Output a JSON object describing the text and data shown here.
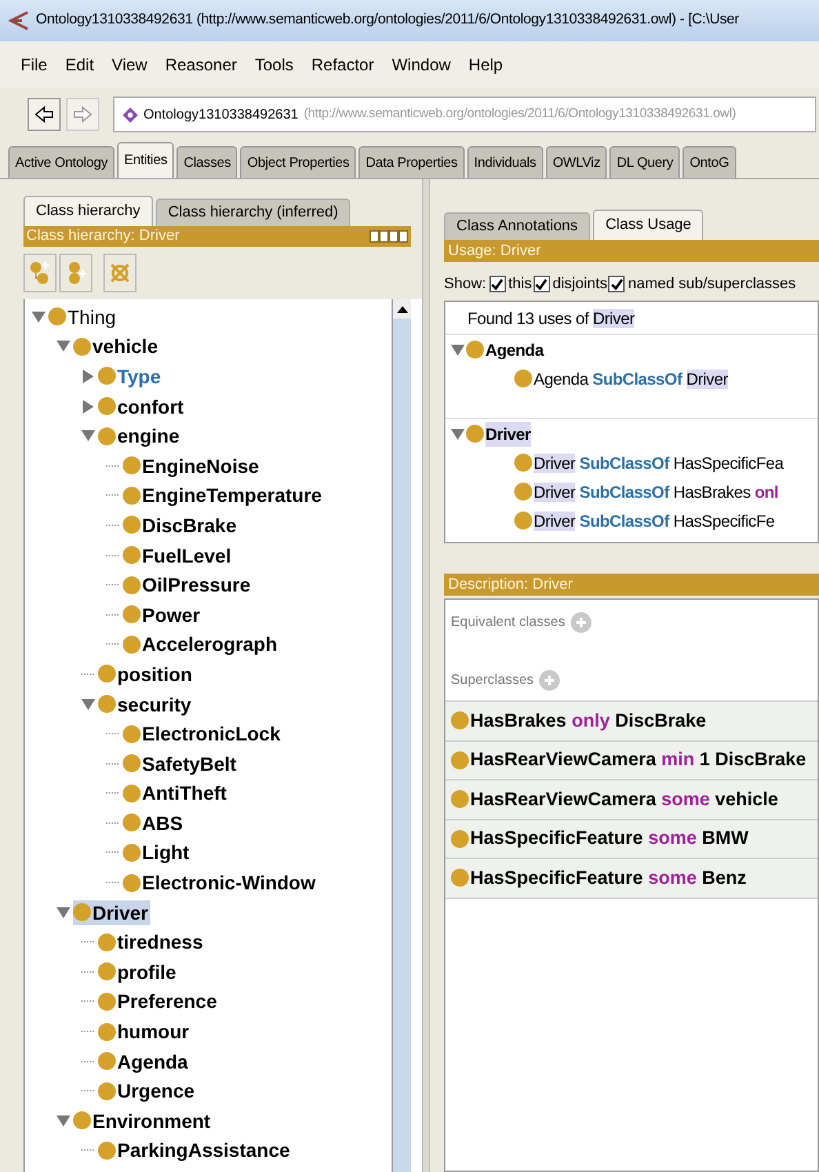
{
  "window": {
    "title": "Ontology1310338492631 (http://www.semanticweb.org/ontologies/2011/6/Ontology1310338492631.owl) - [C:\\User"
  },
  "menu": [
    "File",
    "Edit",
    "View",
    "Reasoner",
    "Tools",
    "Refactor",
    "Window",
    "Help"
  ],
  "nav": {
    "ontology": "Ontology1310338492631",
    "iri": "(http://www.semanticweb.org/ontologies/2011/6/Ontology1310338492631.owl)"
  },
  "tabs": [
    {
      "label": "Active Ontology",
      "selected": false
    },
    {
      "label": "Entities",
      "selected": true
    },
    {
      "label": "Classes",
      "selected": false
    },
    {
      "label": "Object Properties",
      "selected": false
    },
    {
      "label": "Data Properties",
      "selected": false
    },
    {
      "label": "Individuals",
      "selected": false
    },
    {
      "label": "OWLViz",
      "selected": false
    },
    {
      "label": "DL Query",
      "selected": false
    },
    {
      "label": "OntoG",
      "selected": false
    }
  ],
  "hierarchy": {
    "tabs": [
      {
        "label": "Class hierarchy",
        "selected": true
      },
      {
        "label": "Class hierarchy (inferred)",
        "selected": false
      }
    ],
    "header": "Class hierarchy: Driver",
    "tree": [
      {
        "label": "Thing",
        "kind": "branch",
        "expanded": true,
        "selected": false,
        "hovered": false,
        "children": [
          {
            "label": "vehicle",
            "kind": "branch",
            "expanded": true,
            "selected": false,
            "hovered": false,
            "children": [
              {
                "label": "Type",
                "kind": "branch",
                "expanded": false,
                "selected": false,
                "hovered": true
              },
              {
                "label": "confort",
                "kind": "branch",
                "expanded": false,
                "selected": false,
                "hovered": false
              },
              {
                "label": "engine",
                "kind": "branch",
                "expanded": true,
                "selected": false,
                "hovered": false,
                "children": [
                  {
                    "label": "EngineNoise",
                    "kind": "leaf",
                    "selected": false,
                    "hovered": false
                  },
                  {
                    "label": "EngineTemperature",
                    "kind": "leaf",
                    "selected": false,
                    "hovered": false
                  },
                  {
                    "label": "DiscBrake",
                    "kind": "leaf",
                    "selected": false,
                    "hovered": false
                  },
                  {
                    "label": "FuelLevel",
                    "kind": "leaf",
                    "selected": false,
                    "hovered": false
                  },
                  {
                    "label": "OilPressure",
                    "kind": "leaf",
                    "selected": false,
                    "hovered": false
                  },
                  {
                    "label": "Power",
                    "kind": "leaf",
                    "selected": false,
                    "hovered": false
                  },
                  {
                    "label": "Accelerograph",
                    "kind": "leaf",
                    "selected": false,
                    "hovered": false
                  }
                ]
              },
              {
                "label": "position",
                "kind": "leaf",
                "selected": false,
                "hovered": false
              },
              {
                "label": "security",
                "kind": "branch",
                "expanded": true,
                "selected": false,
                "hovered": false,
                "children": [
                  {
                    "label": "ElectronicLock",
                    "kind": "leaf",
                    "selected": false,
                    "hovered": false
                  },
                  {
                    "label": "SafetyBelt",
                    "kind": "leaf",
                    "selected": false,
                    "hovered": false
                  },
                  {
                    "label": "AntiTheft",
                    "kind": "leaf",
                    "selected": false,
                    "hovered": false
                  },
                  {
                    "label": "ABS",
                    "kind": "leaf",
                    "selected": false,
                    "hovered": false
                  },
                  {
                    "label": "Light",
                    "kind": "leaf",
                    "selected": false,
                    "hovered": false
                  },
                  {
                    "label": "Electronic-Window",
                    "kind": "leaf",
                    "selected": false,
                    "hovered": false
                  }
                ]
              }
            ]
          },
          {
            "label": "Driver",
            "kind": "branch",
            "expanded": true,
            "selected": true,
            "hovered": false,
            "children": [
              {
                "label": "tiredness",
                "kind": "leaf",
                "selected": false,
                "hovered": false
              },
              {
                "label": "profile",
                "kind": "leaf",
                "selected": false,
                "hovered": false
              },
              {
                "label": "Preference",
                "kind": "leaf",
                "selected": false,
                "hovered": false
              },
              {
                "label": "humour",
                "kind": "leaf",
                "selected": false,
                "hovered": false
              },
              {
                "label": "Agenda",
                "kind": "leaf",
                "selected": false,
                "hovered": false
              },
              {
                "label": "Urgence",
                "kind": "leaf",
                "selected": false,
                "hovered": false
              }
            ]
          },
          {
            "label": "Environment",
            "kind": "branch",
            "expanded": true,
            "selected": false,
            "hovered": false,
            "children": [
              {
                "label": "ParkingAssistance",
                "kind": "leaf",
                "selected": false,
                "hovered": false
              }
            ]
          }
        ]
      }
    ]
  },
  "usage": {
    "tabs": [
      {
        "label": "Class Annotations",
        "selected": false
      },
      {
        "label": "Class Usage",
        "selected": true
      }
    ],
    "header": "Usage: Driver",
    "show_label": "Show:",
    "filters": [
      {
        "label": "this",
        "checked": true
      },
      {
        "label": "disjoints",
        "checked": true
      },
      {
        "label": "named sub/superclasses",
        "checked": true
      }
    ],
    "found": [
      {
        "text": "Found 13 uses of",
        "kind": "plain"
      },
      {
        "text": "Driver",
        "kind": "match"
      }
    ],
    "groups": [
      {
        "label": "Agenda",
        "match": false,
        "expanded": true,
        "items": [
          [
            {
              "text": "Agenda",
              "kind": "plain"
            },
            {
              "text": "SubClassOf",
              "kind": "keyword"
            },
            {
              "text": "Driver",
              "kind": "match"
            }
          ]
        ]
      },
      {
        "label": "Driver",
        "match": true,
        "expanded": true,
        "items": [
          [
            {
              "text": "Driver",
              "kind": "match"
            },
            {
              "text": "SubClassOf",
              "kind": "keyword"
            },
            {
              "text": "HasSpecificFea",
              "kind": "plain"
            }
          ],
          [
            {
              "text": "Driver",
              "kind": "match"
            },
            {
              "text": "SubClassOf",
              "kind": "keyword"
            },
            {
              "text": "HasBrakes",
              "kind": "plain"
            },
            {
              "text": "onl",
              "kind": "restriction"
            }
          ],
          [
            {
              "text": "Driver",
              "kind": "match"
            },
            {
              "text": "SubClassOf",
              "kind": "keyword"
            },
            {
              "text": "HasSpecificFe",
              "kind": "plain"
            }
          ]
        ]
      }
    ]
  },
  "description": {
    "header": "Description: Driver",
    "equivalent_label": "Equivalent classes",
    "superclasses_label": "Superclasses",
    "superclasses": [
      [
        {
          "text": "HasBrakes",
          "kind": "plain"
        },
        {
          "text": "only",
          "kind": "restriction"
        },
        {
          "text": "DiscBrake",
          "kind": "plain"
        }
      ],
      [
        {
          "text": "HasRearViewCamera",
          "kind": "plain"
        },
        {
          "text": "min",
          "kind": "restriction"
        },
        {
          "text": "1 DiscBrake",
          "kind": "plain"
        }
      ],
      [
        {
          "text": "HasRearViewCamera",
          "kind": "plain"
        },
        {
          "text": "some",
          "kind": "restriction"
        },
        {
          "text": "vehicle",
          "kind": "plain"
        }
      ],
      [
        {
          "text": "HasSpecificFeature",
          "kind": "plain"
        },
        {
          "text": "some",
          "kind": "restriction"
        },
        {
          "text": "BMW",
          "kind": "plain"
        }
      ],
      [
        {
          "text": "HasSpecificFeature",
          "kind": "plain"
        },
        {
          "text": "some",
          "kind": "restriction"
        },
        {
          "text": "Benz",
          "kind": "plain"
        }
      ]
    ]
  }
}
